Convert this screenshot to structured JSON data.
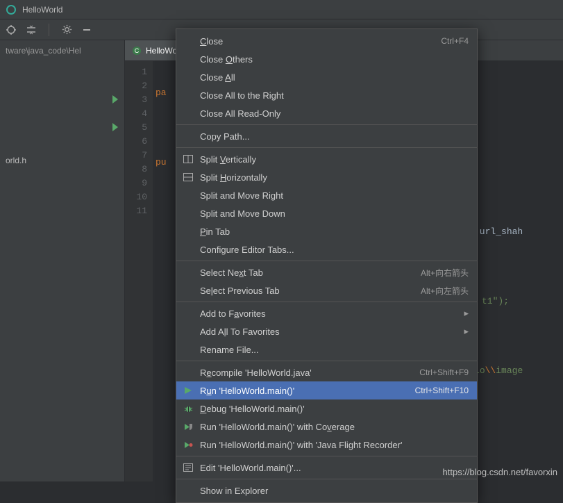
{
  "window": {
    "title": "HelloWorld"
  },
  "sidebar": {
    "path": "tware\\java_code\\Hel",
    "tree_item": "orld.h"
  },
  "tabs": [
    {
      "label": "HelloWorl…",
      "active": true
    },
    {
      "label": "…",
      "active": false
    }
  ],
  "gutter": {
    "lines": [
      "1",
      "2",
      "3",
      "4",
      "5",
      "6",
      "7",
      "8",
      "9",
      "10",
      "11"
    ],
    "run_markers": [
      3,
      5
    ]
  },
  "code": {
    "line1": "pa",
    "line3": "pu",
    "line5_tail": "tring url_shah",
    "line7_str": "t1",
    "line7_tail": "\");",
    "line8_tail": ";",
    "line9_esc1": "\\\\",
    "line9_mid": "hello",
    "line9_esc2": "\\\\",
    "line9_tail": "image",
    "line10_brace": "}"
  },
  "context_menu": {
    "groups": [
      [
        {
          "label1": "C",
          "label2": "lose",
          "shortcut": "Ctrl+F4"
        },
        {
          "label_pre": "Close ",
          "label_mn": "O",
          "label_post": "thers"
        },
        {
          "label_pre": "Close ",
          "label_mn": "A",
          "label_post": "ll"
        },
        {
          "label": "Close All to the Right"
        },
        {
          "label": "Close All Read-Only"
        }
      ],
      [
        {
          "label": "Copy Path..."
        }
      ],
      [
        {
          "label_pre": "Split ",
          "label_mn": "V",
          "label_post": "ertically",
          "icon": "split-v"
        },
        {
          "label_pre": "Split ",
          "label_mn": "H",
          "label_post": "orizontally",
          "icon": "split-h"
        },
        {
          "label": "Split and Move Right"
        },
        {
          "label": "Split and Move Down"
        },
        {
          "label_mn": "P",
          "label_post": "in Tab"
        },
        {
          "label": "Configure Editor Tabs..."
        }
      ],
      [
        {
          "label_pre": "Select Ne",
          "label_mn": "x",
          "label_post": "t Tab",
          "shortcut": "Alt+向右箭头"
        },
        {
          "label_pre": "Se",
          "label_mn": "l",
          "label_post": "ect Previous Tab",
          "shortcut": "Alt+向左箭头"
        }
      ],
      [
        {
          "label_pre": "Add to F",
          "label_mn": "a",
          "label_post": "vorites",
          "submenu": true
        },
        {
          "label_pre": "Add A",
          "label_mn": "l",
          "label_post": "l To Favorites",
          "submenu": true
        },
        {
          "label": "Rename File..."
        }
      ],
      [
        {
          "label_pre": "R",
          "label_mn": "e",
          "label_post": "compile 'HelloWorld.java'",
          "shortcut": "Ctrl+Shift+F9"
        },
        {
          "label_pre": "R",
          "label_mn": "u",
          "label_post": "n 'HelloWorld.main()'",
          "shortcut": "Ctrl+Shift+F10",
          "icon": "run",
          "highlight": true
        },
        {
          "label_mn": "D",
          "label_post": "ebug 'HelloWorld.main()'",
          "icon": "debug"
        },
        {
          "label_pre": "Run 'HelloWorld.main()' with Co",
          "label_mn": "v",
          "label_post": "erage",
          "icon": "coverage"
        },
        {
          "label": "Run 'HelloWorld.main()' with 'Java Flight Recorder'",
          "icon": "flight"
        }
      ],
      [
        {
          "label": "Edit 'HelloWorld.main()'...",
          "icon": "edit-run"
        }
      ],
      [
        {
          "label": "Show in Explorer"
        }
      ]
    ]
  },
  "watermark": "https://blog.csdn.net/favorxin"
}
